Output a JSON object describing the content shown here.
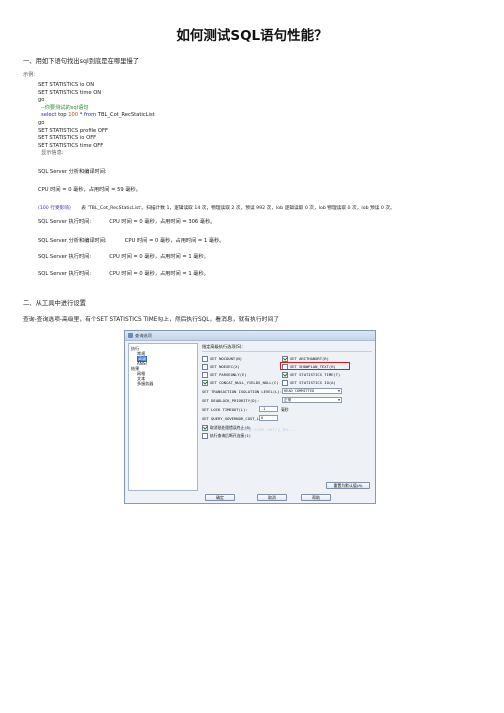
{
  "title": "如何测试SQL语句性能？",
  "section1": "一、用如下语句找出sql到底是在哪里慢了",
  "example_label": "示例:",
  "code": {
    "l1": "SET STATISTICS io ON",
    "l2": "SET STATISTICS time ON",
    "l3": "go",
    "l4": "--你要测试的sql语句",
    "l5_kw": "select",
    "l5_a": " top ",
    "l5_num": "100",
    "l5_b": " * ",
    "l5_from": "from",
    "l5_c": " TBL_Cot_RecStaticList",
    "l6": "go",
    "l7": "SET STATISTICS profile OFF",
    "l8": "SET STATISTICS io OFF",
    "l9": "SET STATISTICS time OFF",
    "l10": "显示信息:"
  },
  "output": {
    "o1": "SQL Server 分析和编译时间:",
    "o2": "CPU 时间 = 0 毫秒，占用时间 = 59 毫秒。",
    "o3a": "(100 行受影响)",
    "o3b": "表 'TBL_Cot_RecStaticList'。扫描计数 1，逻辑读取 14 次，物理读取 2 次，预读 992 次，lob 逻辑读取 0 次，lob 物理读取 0 次，lob 预读 0 次。",
    "o4": "SQL Server 执行时间:           CPU 时间 = 0 毫秒，占用时间 = 306 毫秒。",
    "o5": "SQL Server 分析和编译时间:           CPU 时间 = 0 毫秒，占用时间 = 1 毫秒。",
    "o6": "SQL Server 执行时间:           CPU 时间 = 0 毫秒，占用时间 = 1 毫秒。",
    "o7": "SQL Server 执行时间:           CPU 时间 = 0 毫秒，占用时间 = 1 毫秒。"
  },
  "section2": "二、从工具中进行设置",
  "section2_desc": "查询-查询选项-高级里，有个SET STATISTICS TIME勾上，然后执行SQL，看消息，就有执行时间了",
  "dialog": {
    "title": "查询选项",
    "tree": {
      "exec": "执行",
      "general": "常规",
      "advanced": "高级",
      "ansi": "ANSI",
      "results": "结果",
      "grid": "网格",
      "text": "文本",
      "multi": "多服务器"
    },
    "panel_title": "指定高级执行选项(S):",
    "checkboxes": {
      "nocount": "SET NOCOUNT(N)",
      "noexec": "SET NOEXEC(X)",
      "parseonly": "SET PARSEONLY(E)",
      "concat": "SET CONCAT_NULL_YIELDS_NULL(C)",
      "arithabort": "SET ARITHABORT(R)",
      "showplan": "SET SHOWPLAN_TEXT(H)",
      "stat_time": "SET STATISTICS TIME(T)",
      "stat_io": "SET STATISTICS IO(A)"
    },
    "isolation_label": "SET TRANSACTION ISOLATION LEVEL(L):",
    "isolation_value": "READ COMMITTED",
    "deadlock_label": "SET DEADLOCK_PRIORITY(D):",
    "deadlock_value": "正常",
    "lock_label": "SET LOCK TIMEOUT(L):",
    "lock_value": "-1",
    "lock_unit": "毫秒",
    "query_cost_label": "SET QUERY_GOVERNOR_COST_LIMIT(Q):",
    "query_cost_value": "0",
    "cancel_label": "取消批处理错误终止(B)",
    "disconnect_label": "执行查询后断开连接(I)",
    "watermark": "http://blog.csdn.net/y_bo...",
    "reset_btn": "重置为默认值(R)",
    "ok_btn": "确定",
    "cancel_btn": "取消",
    "help_btn": "帮助"
  }
}
